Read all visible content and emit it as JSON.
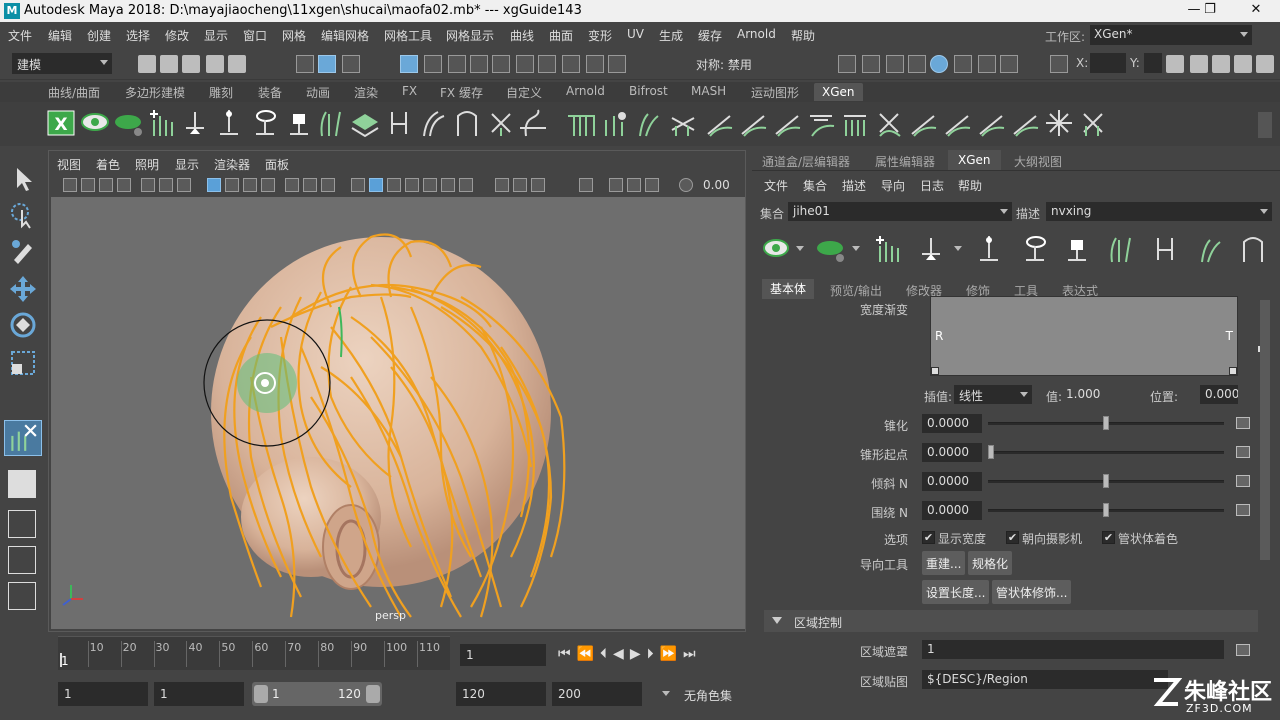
{
  "title": "Autodesk Maya 2018: D:\\mayajiaocheng\\11xgen\\shucai\\maofa02.mb*   ---   xgGuide143",
  "app_logo": "M",
  "window_controls": {
    "minimize": "—",
    "restore": "❐",
    "close": "✕"
  },
  "menubar": [
    "文件",
    "编辑",
    "创建",
    "选择",
    "修改",
    "显示",
    "窗口",
    "网格",
    "编辑网格",
    "网格工具",
    "网格显示",
    "曲线",
    "曲面",
    "变形",
    "UV",
    "生成",
    "缓存",
    "Arnold",
    "帮助"
  ],
  "workspace": {
    "label": "工作区:",
    "value": "XGen*"
  },
  "statusline": {
    "mode": "建模",
    "symmetry": "对称: 禁用",
    "x_label": "X:",
    "y_label": "Y:"
  },
  "shelf_tabs": [
    "曲线/曲面",
    "多边形建模",
    "雕刻",
    "装备",
    "动画",
    "渲染",
    "FX",
    "FX 缓存",
    "自定义",
    "Arnold",
    "Bifrost",
    "MASH",
    "运动图形",
    "XGen"
  ],
  "viewport": {
    "menu": [
      "视图",
      "着色",
      "照明",
      "显示",
      "渲染器",
      "面板"
    ],
    "exposure_value": "0.00",
    "camera": "persp"
  },
  "right_panel": {
    "tabs": [
      "通道盒/层编辑器",
      "属性编辑器",
      "XGen",
      "大纲视图"
    ],
    "menu": [
      "文件",
      "集合",
      "描述",
      "导向",
      "日志",
      "帮助"
    ],
    "collection_label": "集合",
    "collection_value": "jihe01",
    "description_label": "描述",
    "description_value": "nvxing",
    "sub_tabs": [
      "基本体",
      "预览/输出",
      "修改器",
      "修饰",
      "工具",
      "表达式"
    ],
    "ramp": {
      "label": "宽度渐变",
      "left": "R",
      "right": "T"
    },
    "interp": {
      "label": "插值:",
      "value": "线性",
      "value_label": "值:",
      "value_num": "1.000",
      "pos_label": "位置:",
      "pos_value": "0.000"
    },
    "taper": {
      "label": "锥化",
      "value": "0.0000",
      "level": 0.5
    },
    "taper_start": {
      "label": "锥形起点",
      "value": "0.0000",
      "level": 0.0
    },
    "tilt": {
      "label": "倾斜 N",
      "value": "0.0000",
      "level": 0.5
    },
    "around": {
      "label": "围绕 N",
      "value": "0.0000",
      "level": 0.5
    },
    "options": {
      "label": "选项",
      "items": [
        "显示宽度",
        "朝向摄影机",
        "管状体着色"
      ]
    },
    "guide_tools": {
      "label": "导向工具",
      "buttons": [
        "重建...",
        "规格化",
        "设置长度...",
        "管状体修饰..."
      ]
    },
    "region": {
      "section": "区域控制",
      "mask_label": "区域遮罩",
      "mask_value": "1",
      "map_label": "区域贴图",
      "map_value": "${DESC}/Region"
    }
  },
  "timeline": {
    "ticks": [
      "1",
      "10",
      "20",
      "30",
      "40",
      "50",
      "60",
      "70",
      "80",
      "90",
      "100",
      "110"
    ],
    "current": "1"
  },
  "range": {
    "start": "1",
    "playback_start": "1",
    "slider_start": "1",
    "slider_end": "120",
    "playback_end": "120",
    "end": "200",
    "character_set": "无角色集"
  },
  "watermark": {
    "text": "朱峰社区",
    "url": "ZF3D.COM"
  },
  "colors": {
    "hair": "#f0a020",
    "head": "#dcb9a0",
    "viewport_bg": "#6e6e6e",
    "accent_blue": "#5aa0d8"
  }
}
